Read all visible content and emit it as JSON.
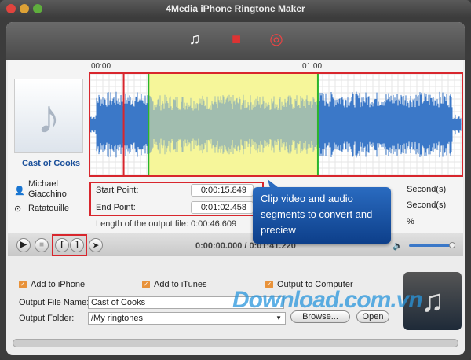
{
  "window": {
    "title": "4Media iPhone Ringtone Maker"
  },
  "toolbar": {
    "icons": [
      "add-file-icon",
      "toolbox-icon",
      "help-lifebuoy-icon"
    ]
  },
  "track": {
    "title": "Cast of Cooks",
    "artist": "Michael Giacchino",
    "album": "Ratatouille"
  },
  "timeline": {
    "labels": [
      "00:00",
      "01:00"
    ]
  },
  "waveform": {
    "selection_start_fraction": 0.157,
    "selection_end_fraction": 0.613,
    "playhead_fraction": 0.09
  },
  "clip": {
    "start_label": "Start Point:",
    "start_value": "0:00:15.849",
    "end_label": "End Point:",
    "end_value": "0:01:02.458",
    "length_label": "Length of the output file:",
    "length_value": "0:00:46.609",
    "unit1": "Second(s)",
    "unit2": "Second(s)",
    "unit3": "%"
  },
  "tooltip": {
    "text": "Clip video and audio segments to convert and preciew"
  },
  "player": {
    "time": "0:00:00.000 / 0:01:41.220",
    "volume": 0.9,
    "start_mark": "[",
    "end_mark": "]"
  },
  "output": {
    "add_iphone": "Add to iPhone",
    "add_itunes": "Add to iTunes",
    "output_computer": "Output to Computer",
    "file_name_label": "Output File Name:",
    "file_name_value": "Cast of Cooks",
    "folder_label": "Output Folder:",
    "folder_value": "/My ringtones",
    "browse": "Browse...",
    "open": "Open",
    "progress": 0
  },
  "watermark": "Download.com.vn",
  "colors": {
    "highlight_red": "#d8262d",
    "selection": "#f5f59a",
    "wave": "#3b78c8",
    "tooltip": "#1d55a8"
  }
}
